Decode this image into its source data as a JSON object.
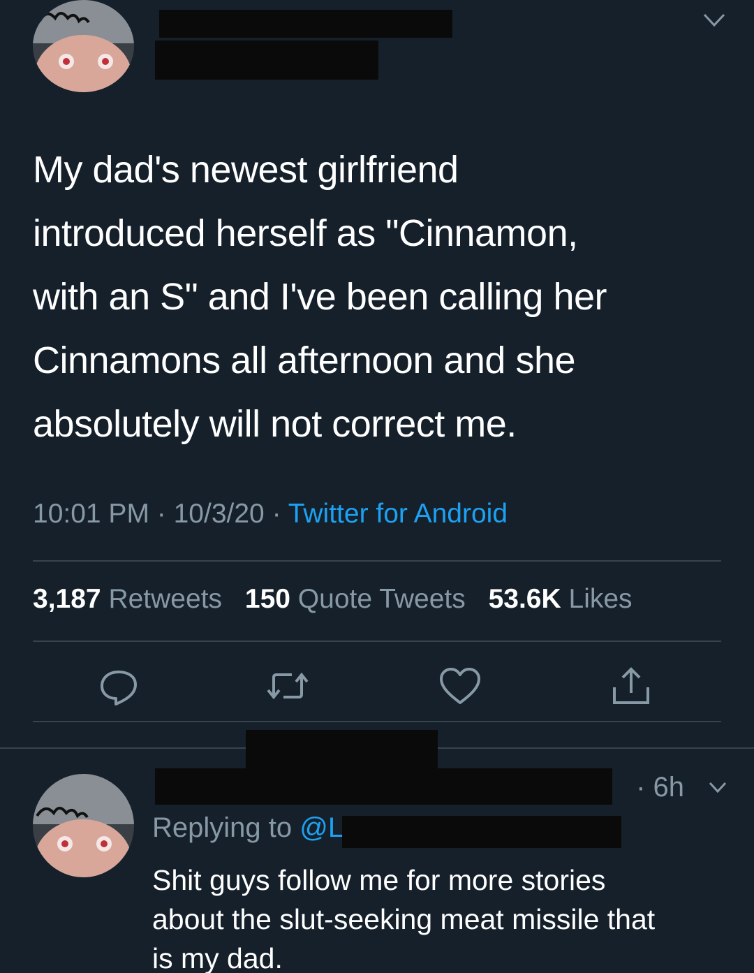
{
  "main_tweet": {
    "text_lines": [
      "My dad's newest girlfriend",
      "introduced herself as \"Cinnamon,",
      "with an S\" and I've been calling her",
      "Cinnamons all afternoon and she",
      "absolutely will not correct me."
    ],
    "time": "10:01 PM",
    "date": "10/3/20",
    "source": "Twitter for Android",
    "separator": " · ",
    "stats": {
      "retweets_count": "3,187",
      "retweets_label": "Retweets",
      "quotes_count": "150",
      "quotes_label": "Quote Tweets",
      "likes_count": "53.6K",
      "likes_label": "Likes"
    },
    "actions": [
      "reply-icon",
      "retweet-icon",
      "like-icon",
      "share-icon"
    ]
  },
  "reply": {
    "time": "· 6h",
    "replying_prefix": "Replying to",
    "replying_handle": "@L",
    "text_lines": [
      "Shit guys follow me for more stories",
      "about the slut-seeking meat missile that",
      "is my dad."
    ]
  },
  "colors": {
    "background": "#15202b",
    "text": "#ffffff",
    "secondary": "#8899a6",
    "accent": "#1da1f2",
    "divider": "#38444d"
  }
}
